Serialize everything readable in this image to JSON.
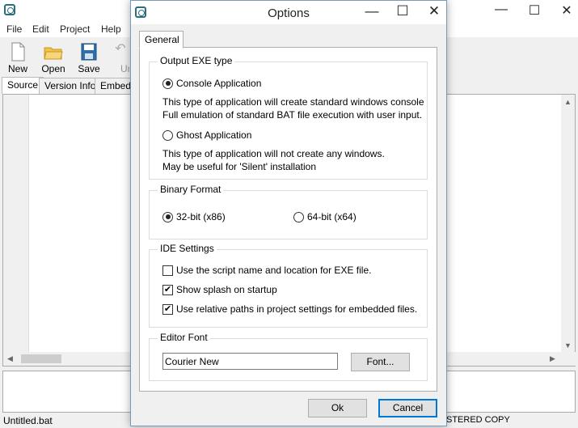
{
  "main": {
    "menu": [
      "File",
      "Edit",
      "Project",
      "Help"
    ],
    "toolbar": [
      {
        "label": "New",
        "icon": "new-file-icon"
      },
      {
        "label": "Open",
        "icon": "open-folder-icon"
      },
      {
        "label": "Save",
        "icon": "save-disk-icon"
      },
      {
        "label": "Un",
        "icon": "undo-icon"
      }
    ],
    "tabs": [
      "Source",
      "Version Info",
      "Embedd"
    ],
    "status_left": "Untitled.bat",
    "status_right": "STERED COPY"
  },
  "dialog": {
    "title": "Options",
    "tab": "General",
    "output_exe": {
      "title": "Output EXE type",
      "console_label": "Console Application",
      "console_desc_1": "This type of application will create standard windows console",
      "console_desc_2": "Full emulation of standard BAT file execution with user input.",
      "ghost_label": "Ghost Application",
      "ghost_desc_1": "This type of application will not create any windows.",
      "ghost_desc_2": "May be useful for 'Silent' installation",
      "selected": "console"
    },
    "binary_format": {
      "title": "Binary Format",
      "opt32": "32-bit (x86)",
      "opt64": "64-bit (x64)",
      "selected": "32"
    },
    "ide_settings": {
      "title": "IDE Settings",
      "items": [
        {
          "label": "Use the script name and location for EXE file.",
          "checked": false
        },
        {
          "label": "Show splash on startup",
          "checked": true
        },
        {
          "label": "Use relative paths in project settings for embedded files.",
          "checked": true
        }
      ]
    },
    "editor_font": {
      "title": "Editor Font",
      "value": "Courier New",
      "button": "Font..."
    },
    "ok_label": "Ok",
    "cancel_label": "Cancel"
  }
}
